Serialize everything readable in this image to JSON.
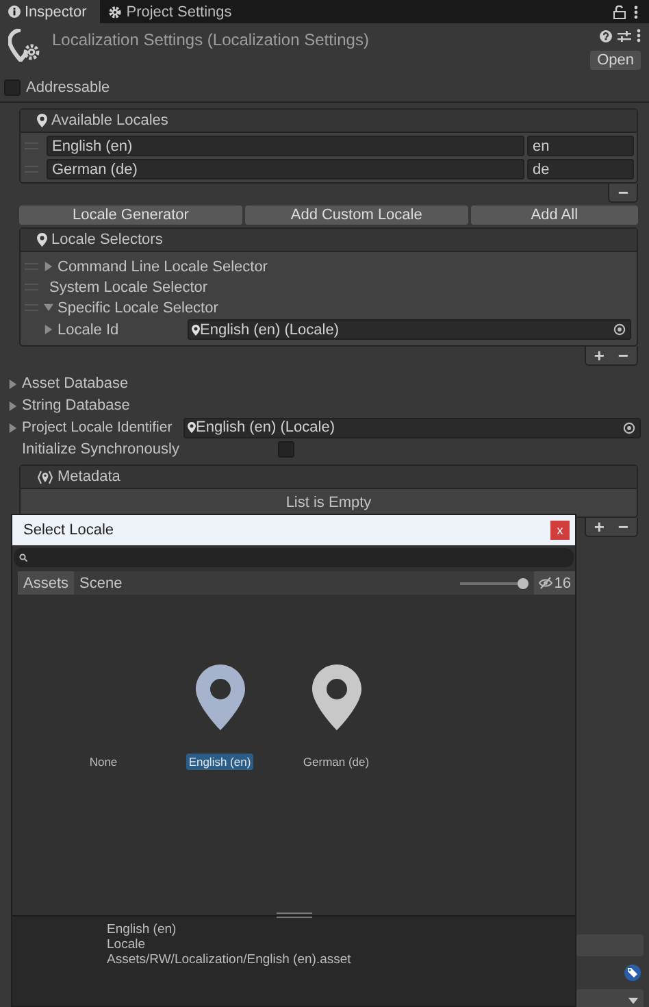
{
  "tabs": [
    {
      "label": "Inspector",
      "selected": true,
      "kind": "info"
    },
    {
      "label": "Project Settings",
      "selected": false,
      "kind": "gear"
    }
  ],
  "header": {
    "title": "Localization Settings (Localization Settings)",
    "button": "Open"
  },
  "addressable": {
    "label": "Addressable",
    "checked": false
  },
  "available_locales": {
    "title": "Available Locales",
    "rows": [
      {
        "name": "English (en)",
        "code": "en"
      },
      {
        "name": "German (de)",
        "code": "de"
      }
    ],
    "footer": [
      "−"
    ]
  },
  "buttons": [
    "Locale Generator",
    "Add Custom Locale",
    "Add All"
  ],
  "locale_selectors": {
    "title": "Locale Selectors",
    "items": [
      {
        "label": "Command Line Locale Selector",
        "kind": "foldout",
        "expanded": false
      },
      {
        "label": "System Locale Selector",
        "kind": "plain"
      },
      {
        "label": "Specific Locale Selector",
        "kind": "foldout",
        "expanded": true,
        "children": [
          {
            "label": "Locale Id",
            "value": "English (en) (Locale)"
          }
        ]
      }
    ],
    "footer": [
      "+",
      "−"
    ]
  },
  "fields": [
    {
      "kind": "foldout",
      "label": "Asset Database",
      "expanded": false
    },
    {
      "kind": "foldout",
      "label": "String Database",
      "expanded": false
    },
    {
      "kind": "object",
      "label": "Project Locale Identifier",
      "expanded": false,
      "value": "English (en) (Locale)"
    },
    {
      "kind": "toggle",
      "label": "Initialize Synchronously",
      "checked": false
    }
  ],
  "metadata": {
    "title": "Metadata",
    "empty_text": "List is Empty",
    "footer": [
      "+",
      "−"
    ]
  },
  "popup": {
    "title": "Select Locale",
    "close": "x",
    "tabs": [
      {
        "label": "Assets",
        "selected": true
      },
      {
        "label": "Scene",
        "selected": false
      }
    ],
    "zoom": {
      "level": 1
    },
    "hidden_count": "16",
    "items": [
      {
        "label": "None",
        "kind": "none",
        "selected": false
      },
      {
        "label": "English (en)",
        "kind": "locale",
        "selected": true
      },
      {
        "label": "German (de)",
        "kind": "locale",
        "selected": false
      }
    ],
    "info": [
      "English (en)",
      "Locale",
      "Assets/RW/Localization/English (en).asset"
    ]
  }
}
